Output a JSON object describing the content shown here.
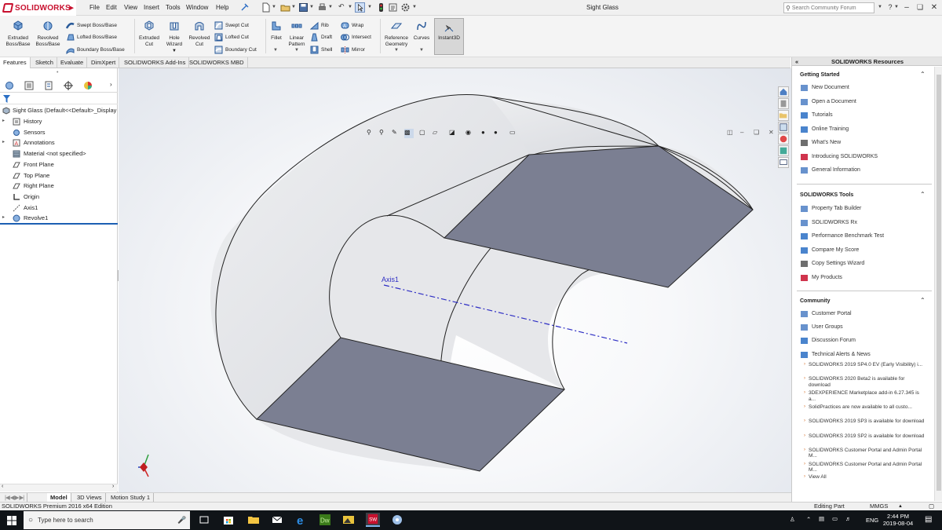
{
  "app": {
    "brand": "SOLIDWORKS",
    "document_title": "Sight Glass",
    "menus": [
      "File",
      "Edit",
      "View",
      "Insert",
      "Tools",
      "Window",
      "Help"
    ],
    "search_placeholder": "Search Community Forum"
  },
  "command_manager": {
    "extruded_boss": "Extruded Boss/Base",
    "revolved_boss": "Revolved Boss/Base",
    "swept_boss": "Swept Boss/Base",
    "lofted_boss": "Lofted Boss/Base",
    "boundary_boss": "Boundary Boss/Base",
    "extruded_cut": "Extruded Cut",
    "hole_wizard": "Hole Wizard",
    "revolved_cut": "Revolved Cut",
    "swept_cut": "Swept Cut",
    "lofted_cut": "Lofted Cut",
    "boundary_cut": "Boundary Cut",
    "fillet": "Fillet",
    "linear_pattern": "Linear Pattern",
    "rib": "Rib",
    "draft": "Draft",
    "shell": "Shell",
    "wrap": "Wrap",
    "intersect": "Intersect",
    "mirror": "Mirror",
    "reference_geometry": "Reference Geometry",
    "curves": "Curves",
    "instant3d": "Instant3D"
  },
  "tabs": [
    "Features",
    "Sketch",
    "Evaluate",
    "DimXpert",
    "SOLIDWORKS Add-Ins",
    "SOLIDWORKS MBD"
  ],
  "feature_tree": {
    "root": "Sight Glass  (Default<<Default>_Display",
    "items": [
      {
        "label": "History",
        "icon": "history-icon",
        "expandable": true
      },
      {
        "label": "Sensors",
        "icon": "sensor-icon",
        "expandable": false
      },
      {
        "label": "Annotations",
        "icon": "annotations-icon",
        "expandable": true
      },
      {
        "label": "Material <not specified>",
        "icon": "material-icon",
        "expandable": false
      },
      {
        "label": "Front Plane",
        "icon": "plane-icon",
        "expandable": false
      },
      {
        "label": "Top Plane",
        "icon": "plane-icon",
        "expandable": false
      },
      {
        "label": "Right Plane",
        "icon": "plane-icon",
        "expandable": false
      },
      {
        "label": "Origin",
        "icon": "origin-icon",
        "expandable": false
      },
      {
        "label": "Axis1",
        "icon": "axis-icon",
        "expandable": false
      },
      {
        "label": "Revolve1",
        "icon": "revolve-icon",
        "expandable": true
      }
    ]
  },
  "graphics": {
    "axis_label": "Axis1",
    "axis_color": "#2e2ec4",
    "cut_face_color": "#7b7f92",
    "body_color": "#e3e4e7"
  },
  "resources": {
    "title": "SOLIDWORKS Resources",
    "getting_started": {
      "title": "Getting Started",
      "items": [
        "New Document",
        "Open a Document",
        "Tutorials",
        "Online Training",
        "What's New",
        "Introducing SOLIDWORKS",
        "General Information"
      ]
    },
    "tools": {
      "title": "SOLIDWORKS Tools",
      "items": [
        "Property Tab Builder",
        "SOLIDWORKS Rx",
        "Performance Benchmark Test",
        "Compare My Score",
        "Copy Settings Wizard",
        "My Products"
      ]
    },
    "community": {
      "title": "Community",
      "items": [
        "Customer Portal",
        "User Groups",
        "Discussion Forum",
        "Technical Alerts & News"
      ]
    },
    "news": [
      "SOLIDWORKS 2019 SP4.0 EV (Early Visibility) i...",
      "SOLIDWORKS 2020 Beta2 is available for download",
      "3DEXPERIENCE Marketplace add-in 6.27.345 is a...",
      "SolidPractices are now available to all custo...",
      "SOLIDWORKS 2019 SP3 is available for download",
      "SOLIDWORKS 2019 SP2 is available for download",
      "SOLIDWORKS Customer Portal and Admin Portal M...",
      "SOLIDWORKS Customer Portal and Admin Portal M..."
    ],
    "view_all": "View All"
  },
  "bottom_tabs": [
    "Model",
    "3D Views",
    "Motion Study 1"
  ],
  "status": {
    "edition": "SOLIDWORKS Premium 2016 x64 Edition",
    "mode": "Editing Part",
    "units": "MMGS"
  },
  "taskbar": {
    "search_placeholder": "Type here to search",
    "language": "ENG",
    "time": "2:44 PM",
    "date": "2019-08-04"
  }
}
